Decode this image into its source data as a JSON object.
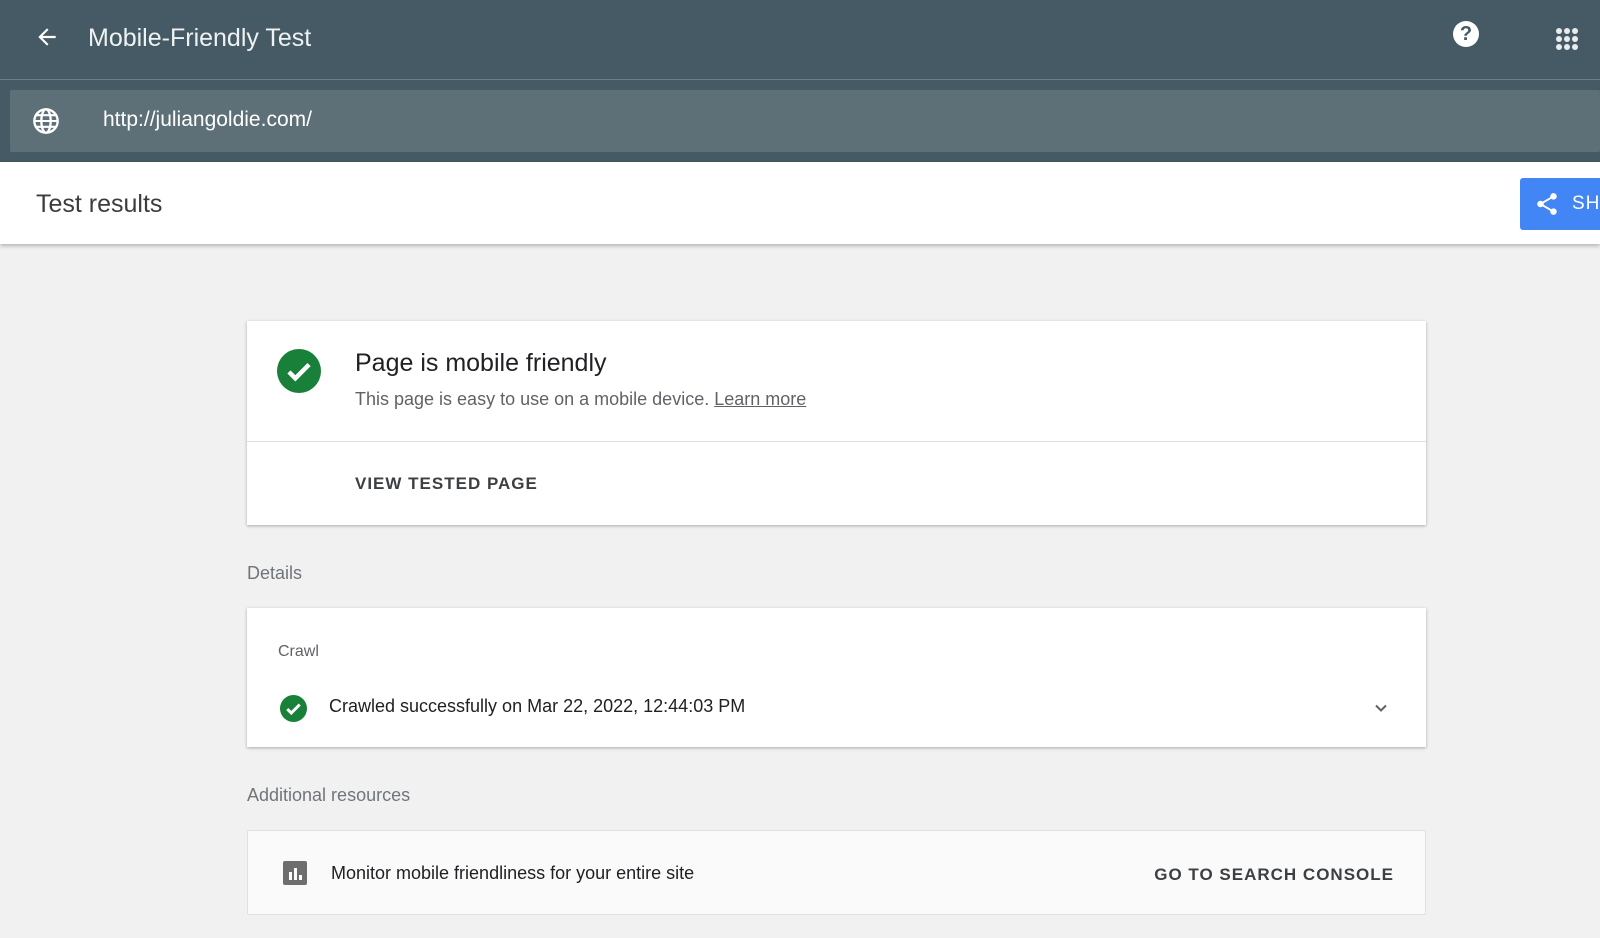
{
  "header": {
    "title": "Mobile-Friendly Test",
    "back_icon": "arrow-back-icon",
    "help_icon": "help-icon",
    "apps_icon": "apps-grid-icon"
  },
  "url_bar": {
    "value": "http://juliangoldie.com/",
    "icon": "globe-icon"
  },
  "results_bar": {
    "title": "Test results",
    "share_label": "SHA"
  },
  "result_card": {
    "status": "pass",
    "heading": "Page is mobile friendly",
    "description": "This page is easy to use on a mobile device.",
    "learn_more": "Learn more",
    "view_tested_page": "VIEW TESTED PAGE"
  },
  "details": {
    "label": "Details",
    "crawl_label": "Crawl",
    "crawl_status": "Crawled successfully on Mar 22, 2022, 12:44:03 PM"
  },
  "additional": {
    "label": "Additional resources",
    "monitor_text": "Monitor mobile friendliness for your entire site",
    "search_console_label": "GO TO SEARCH CONSOLE"
  },
  "colors": {
    "header": "#455a64",
    "success": "#188038",
    "share": "#4285f4"
  }
}
